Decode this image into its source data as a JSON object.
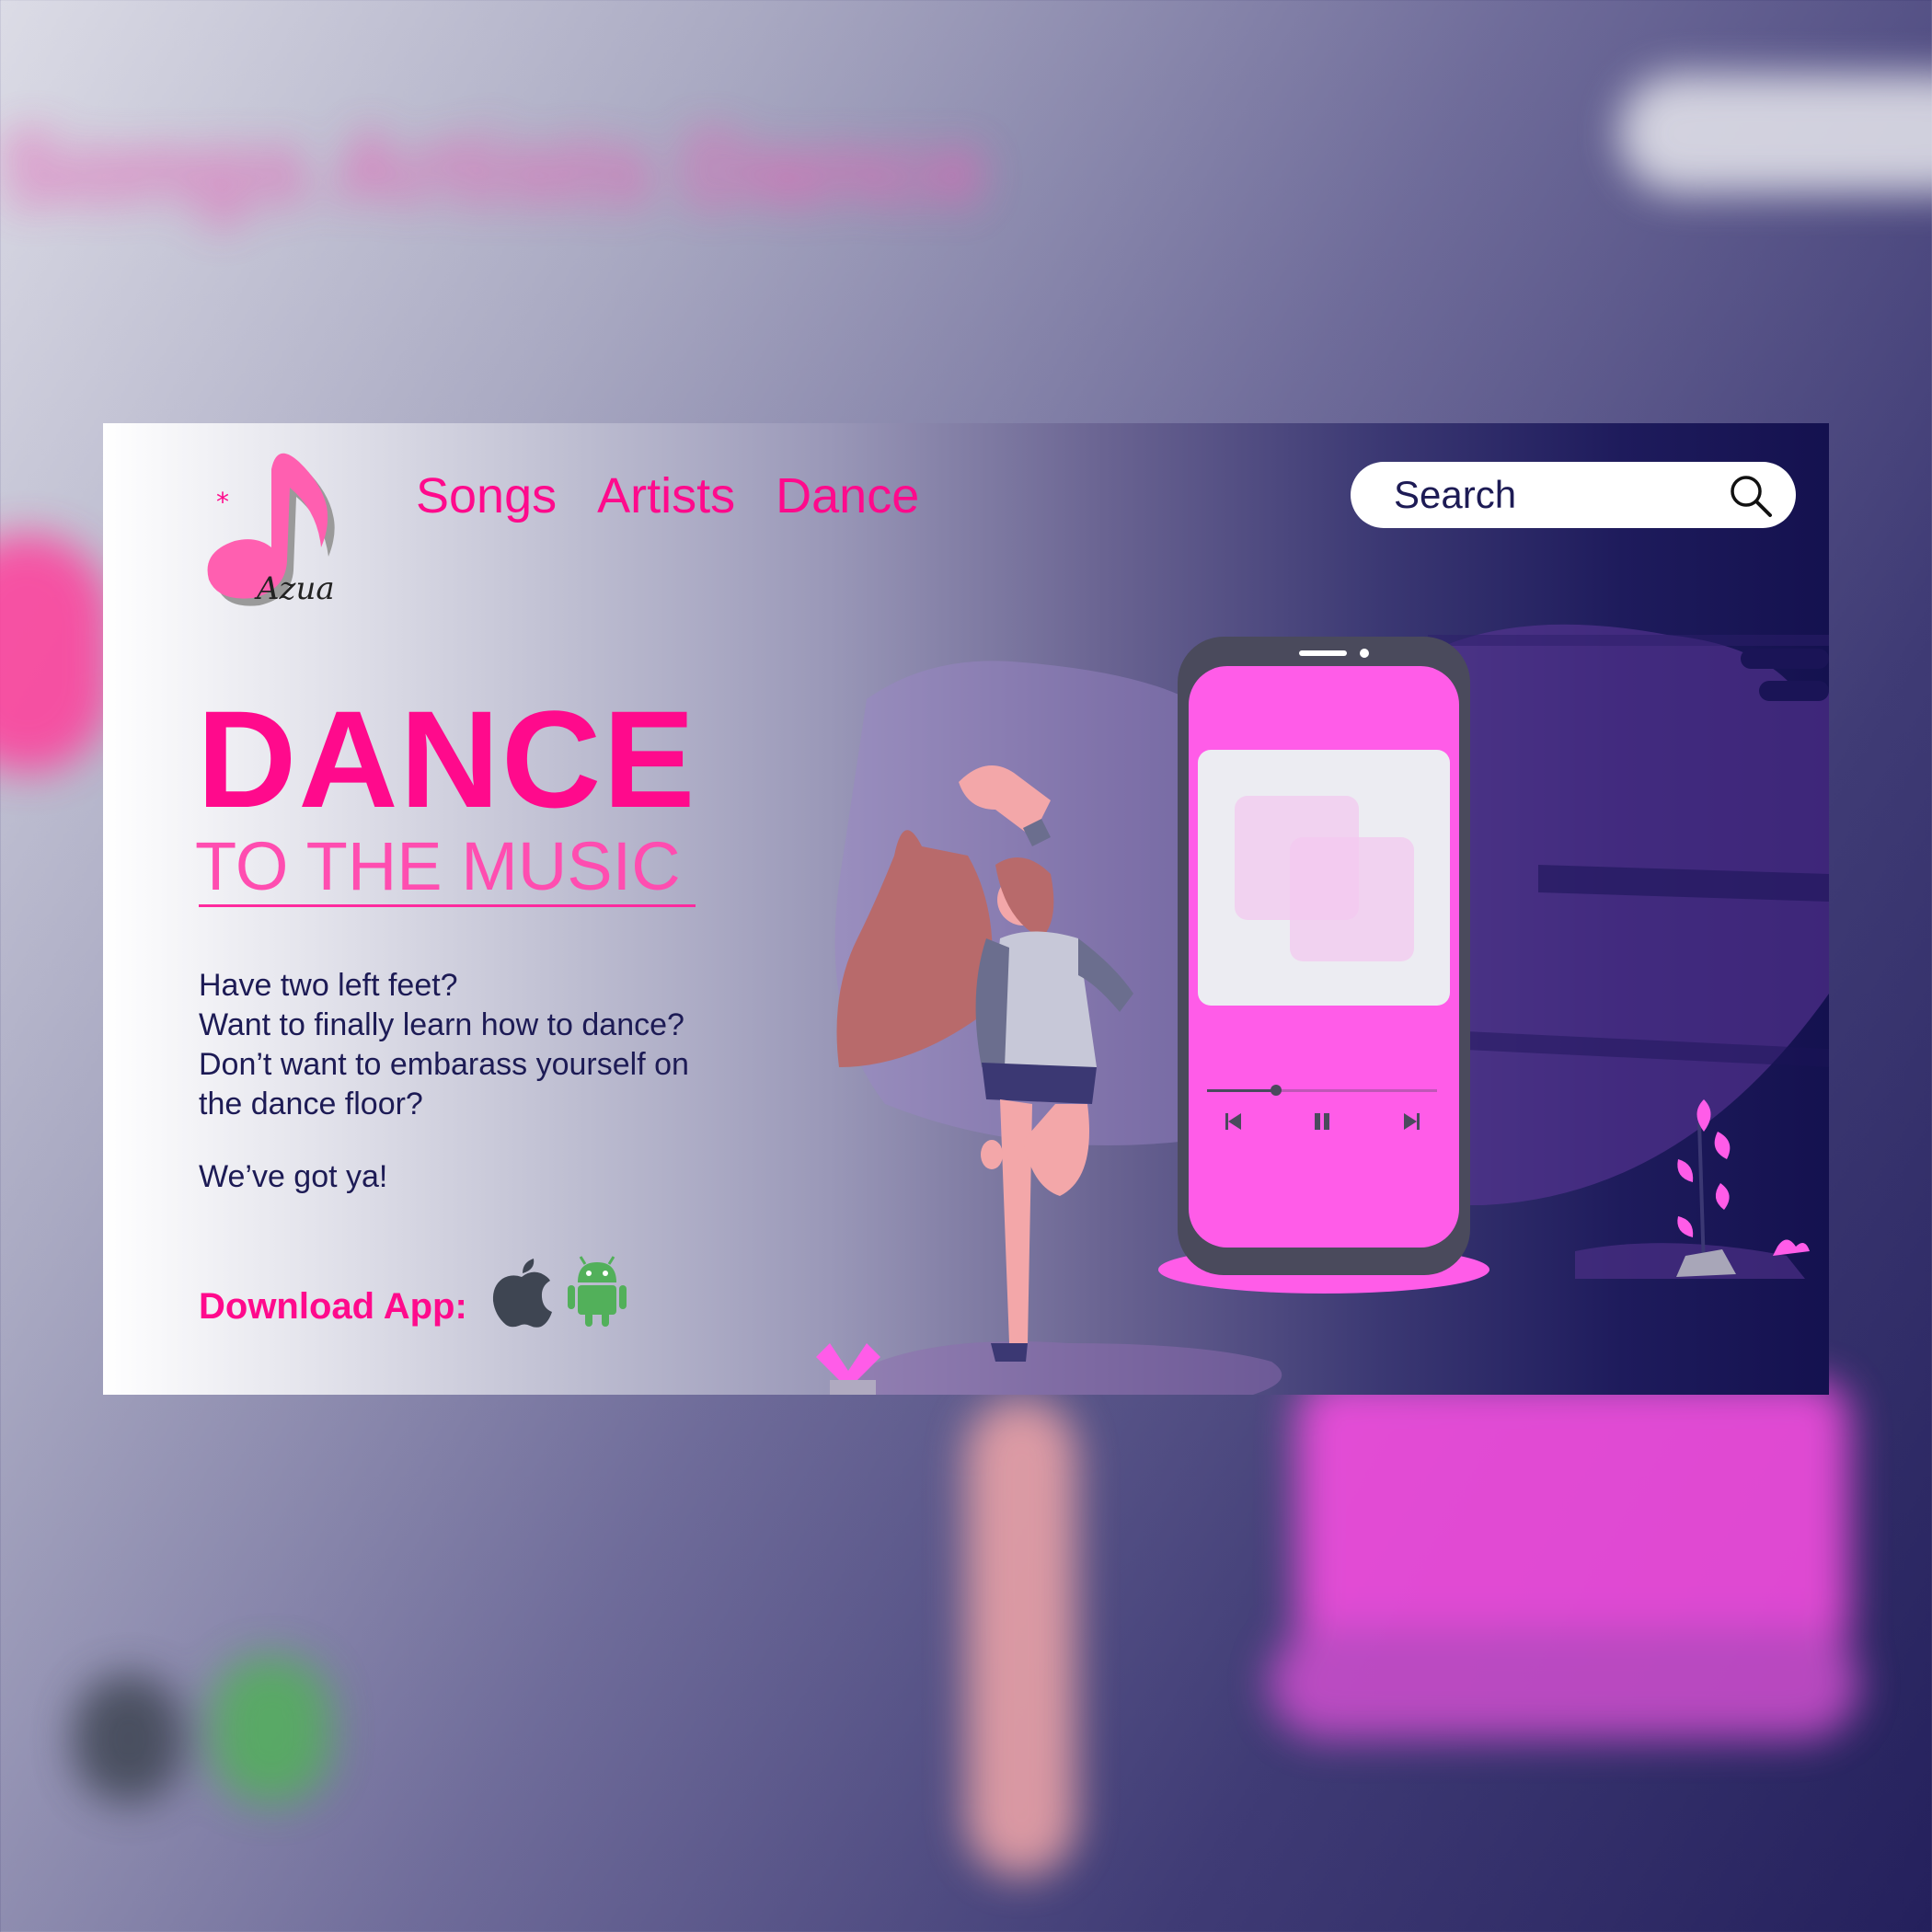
{
  "brand": {
    "logo_text": "Azua"
  },
  "nav": {
    "items": [
      "Songs",
      "Artists",
      "Dance"
    ]
  },
  "search": {
    "placeholder": "Search"
  },
  "hero": {
    "title": "DANCE",
    "subtitle": "TO THE MUSIC",
    "lines": [
      "Have two left feet?",
      "Want to finally learn how to dance?",
      "Don’t want to embarass yourself on",
      "the dance floor?"
    ],
    "tagline": "We’ve got ya!"
  },
  "download": {
    "label": "Download App:",
    "platforms": [
      "apple-icon",
      "android-icon"
    ]
  },
  "player": {
    "progress": 0.3,
    "controls": [
      "previous-icon",
      "pause-icon",
      "next-icon"
    ]
  },
  "colors": {
    "primary_pink": "#ff0a8c",
    "phone_pink": "#ff5ce8",
    "text_navy": "#1d1b55",
    "android_green": "#52b05a",
    "apple_gray": "#3e4552"
  }
}
